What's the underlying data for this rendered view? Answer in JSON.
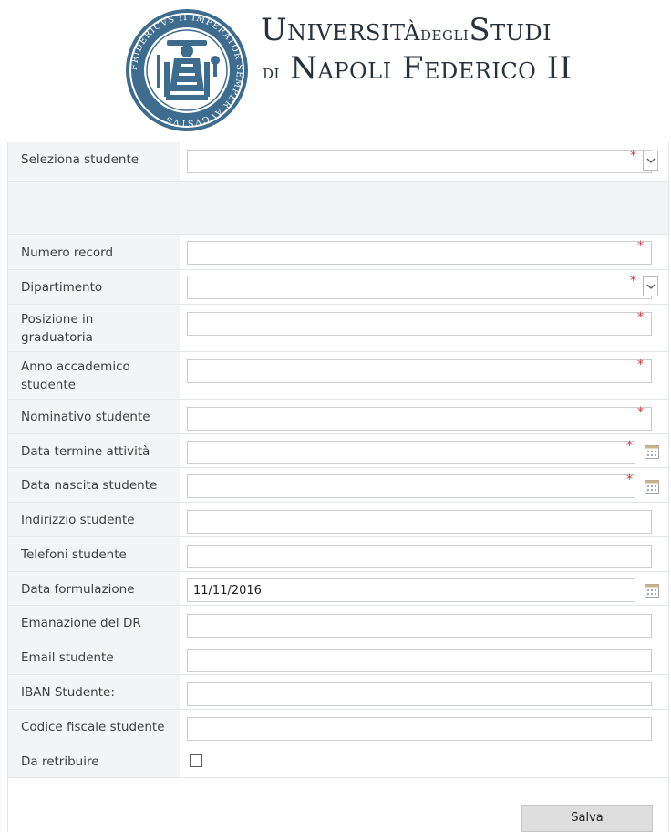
{
  "header": {
    "title_line1_part1": "Università",
    "title_line1_part2": "degli",
    "title_line1_part3": "Studi",
    "title_line2_part1": "di",
    "title_line2_part2": "Napoli Federico II",
    "seal_text": "FRIDERICVS II IMPERATOR SEMPER AVGVSTVS"
  },
  "form": {
    "seleziona_studente": {
      "label": "Seleziona studente",
      "value": ""
    },
    "numero_record": {
      "label": "Numero record",
      "value": ""
    },
    "dipartimento": {
      "label": "Dipartimento",
      "value": ""
    },
    "posizione": {
      "label": "Posizione in graduatoria",
      "value": ""
    },
    "anno": {
      "label": "Anno accademico studente",
      "value": ""
    },
    "nominativo": {
      "label": "Nominativo studente",
      "value": ""
    },
    "data_termine": {
      "label": "Data termine attività",
      "value": ""
    },
    "data_nascita": {
      "label": "Data nascita studente",
      "value": ""
    },
    "indirizzo": {
      "label": "Indirizzio studente",
      "value": ""
    },
    "telefoni": {
      "label": "Telefoni studente",
      "value": ""
    },
    "data_formulazione": {
      "label": "Data formulazione",
      "value": "11/11/2016"
    },
    "emanazione": {
      "label": "Emanazione del DR",
      "value": ""
    },
    "email": {
      "label": "Email studente",
      "value": ""
    },
    "iban": {
      "label": "IBAN Studente:",
      "value": ""
    },
    "codice_fiscale": {
      "label": "Codice fiscale studente",
      "value": ""
    },
    "da_retribuire": {
      "label": "Da retribuire",
      "checked": false
    },
    "required_marker": "*"
  },
  "actions": {
    "save_label": "Salva"
  },
  "colors": {
    "required": "#d43a3a",
    "label_bg": "#f3f4f6",
    "button_bg": "#dedede"
  },
  "icons": {
    "dropdown": "chevron-down-icon",
    "calendar": "calendar-icon",
    "seal": "university-seal"
  }
}
